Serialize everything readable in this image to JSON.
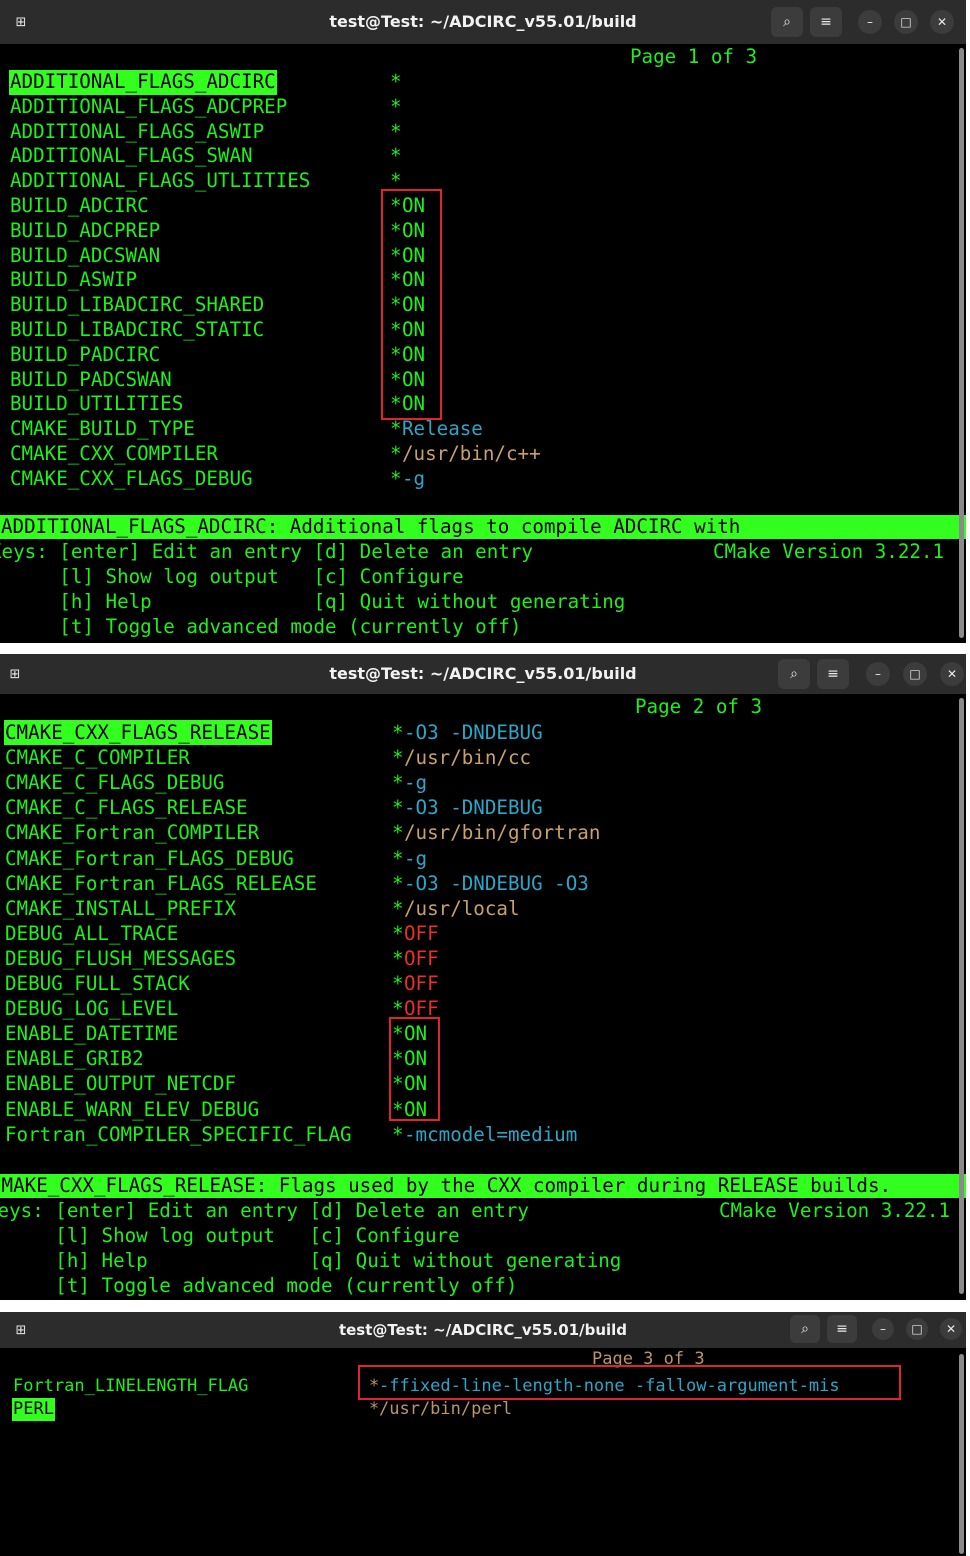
{
  "window_title": "test@Test: ~/ADCIRC_v55.01/build",
  "colors": {
    "terminal_green": "#1ef01a",
    "highlight": "#33ff1f",
    "cyan": "#2aa7c8",
    "brown": "#c9a06a",
    "red": "#e8302a",
    "annotation_box": "#e0242e"
  },
  "keys": {
    "line1_a": "Keys: [enter] Edit an entry [d] Delete an entry",
    "version": "CMake Version 3.22.1",
    "line2": "      [l] Show log output   [c] Configure",
    "line3": "      [h] Help              [q] Quit without generating",
    "line4": "      [t] Toggle advanced mode (currently off)"
  },
  "screen1": {
    "page": "Page 1 of 3",
    "rows": [
      {
        "name": "ADDITIONAL_FLAGS_ADCIRC",
        "star": "*",
        "value": ""
      },
      {
        "name": "ADDITIONAL_FLAGS_ADCPREP",
        "star": "*",
        "value": ""
      },
      {
        "name": "ADDITIONAL_FLAGS_ASWIP",
        "star": "*",
        "value": ""
      },
      {
        "name": "ADDITIONAL_FLAGS_SWAN",
        "star": "*",
        "value": ""
      },
      {
        "name": "ADDITIONAL_FLAGS_UTLIITIES",
        "star": "*",
        "value": ""
      },
      {
        "name": "BUILD_ADCIRC",
        "star": "*",
        "value": "ON"
      },
      {
        "name": "BUILD_ADCPREP",
        "star": "*",
        "value": "ON"
      },
      {
        "name": "BUILD_ADCSWAN",
        "star": "*",
        "value": "ON"
      },
      {
        "name": "BUILD_ASWIP",
        "star": "*",
        "value": "ON"
      },
      {
        "name": "BUILD_LIBADCIRC_SHARED",
        "star": "*",
        "value": "ON"
      },
      {
        "name": "BUILD_LIBADCIRC_STATIC",
        "star": "*",
        "value": "ON"
      },
      {
        "name": "BUILD_PADCIRC",
        "star": "*",
        "value": "ON"
      },
      {
        "name": "BUILD_PADCSWAN",
        "star": "*",
        "value": "ON"
      },
      {
        "name": "BUILD_UTILITIES",
        "star": "*",
        "value": "ON"
      },
      {
        "name": "CMAKE_BUILD_TYPE",
        "star": "*",
        "value": "Release"
      },
      {
        "name": "CMAKE_CXX_COMPILER",
        "star": "*",
        "value": "/usr/bin/c++"
      },
      {
        "name": "CMAKE_CXX_FLAGS_DEBUG",
        "star": "*",
        "value": "-g"
      }
    ],
    "status": "ADDITIONAL_FLAGS_ADCIRC: Additional flags to compile ADCIRC with"
  },
  "screen2": {
    "page": "Page 2 of 3",
    "rows": [
      {
        "name": "CMAKE_CXX_FLAGS_RELEASE",
        "star": "*",
        "value": "-O3 -DNDEBUG"
      },
      {
        "name": "CMAKE_C_COMPILER",
        "star": "*",
        "value": "/usr/bin/cc"
      },
      {
        "name": "CMAKE_C_FLAGS_DEBUG",
        "star": "*",
        "value": "-g"
      },
      {
        "name": "CMAKE_C_FLAGS_RELEASE",
        "star": "*",
        "value": "-O3 -DNDEBUG"
      },
      {
        "name": "CMAKE_Fortran_COMPILER",
        "star": "*",
        "value": "/usr/bin/gfortran"
      },
      {
        "name": "CMAKE_Fortran_FLAGS_DEBUG",
        "star": "*",
        "value": "-g"
      },
      {
        "name": "CMAKE_Fortran_FLAGS_RELEASE",
        "star": "*",
        "value": "-O3 -DNDEBUG -O3"
      },
      {
        "name": "CMAKE_INSTALL_PREFIX",
        "star": "*",
        "value": "/usr/local"
      },
      {
        "name": "DEBUG_ALL_TRACE",
        "star": "*",
        "value": "OFF"
      },
      {
        "name": "DEBUG_FLUSH_MESSAGES",
        "star": "*",
        "value": "OFF"
      },
      {
        "name": "DEBUG_FULL_STACK",
        "star": "*",
        "value": "OFF"
      },
      {
        "name": "DEBUG_LOG_LEVEL",
        "star": "*",
        "value": "OFF"
      },
      {
        "name": "ENABLE_DATETIME",
        "star": "*",
        "value": "ON"
      },
      {
        "name": "ENABLE_GRIB2",
        "star": "*",
        "value": "ON"
      },
      {
        "name": "ENABLE_OUTPUT_NETCDF",
        "star": "*",
        "value": "ON"
      },
      {
        "name": "ENABLE_WARN_ELEV_DEBUG",
        "star": "*",
        "value": "ON"
      },
      {
        "name": "Fortran_COMPILER_SPECIFIC_FLAG",
        "star": "*",
        "value": "-mcmodel=medium"
      }
    ],
    "status": "CMAKE_CXX_FLAGS_RELEASE: Flags used by the CXX compiler during RELEASE builds."
  },
  "screen3": {
    "page": "Page 3 of 3",
    "rows": [
      {
        "name": "Fortran_LINELENGTH_FLAG",
        "star": "*",
        "value": "-ffixed-line-length-none -fallow-argument-mis"
      },
      {
        "name": "PERL",
        "star": "*",
        "value": "/usr/bin/perl"
      }
    ]
  }
}
